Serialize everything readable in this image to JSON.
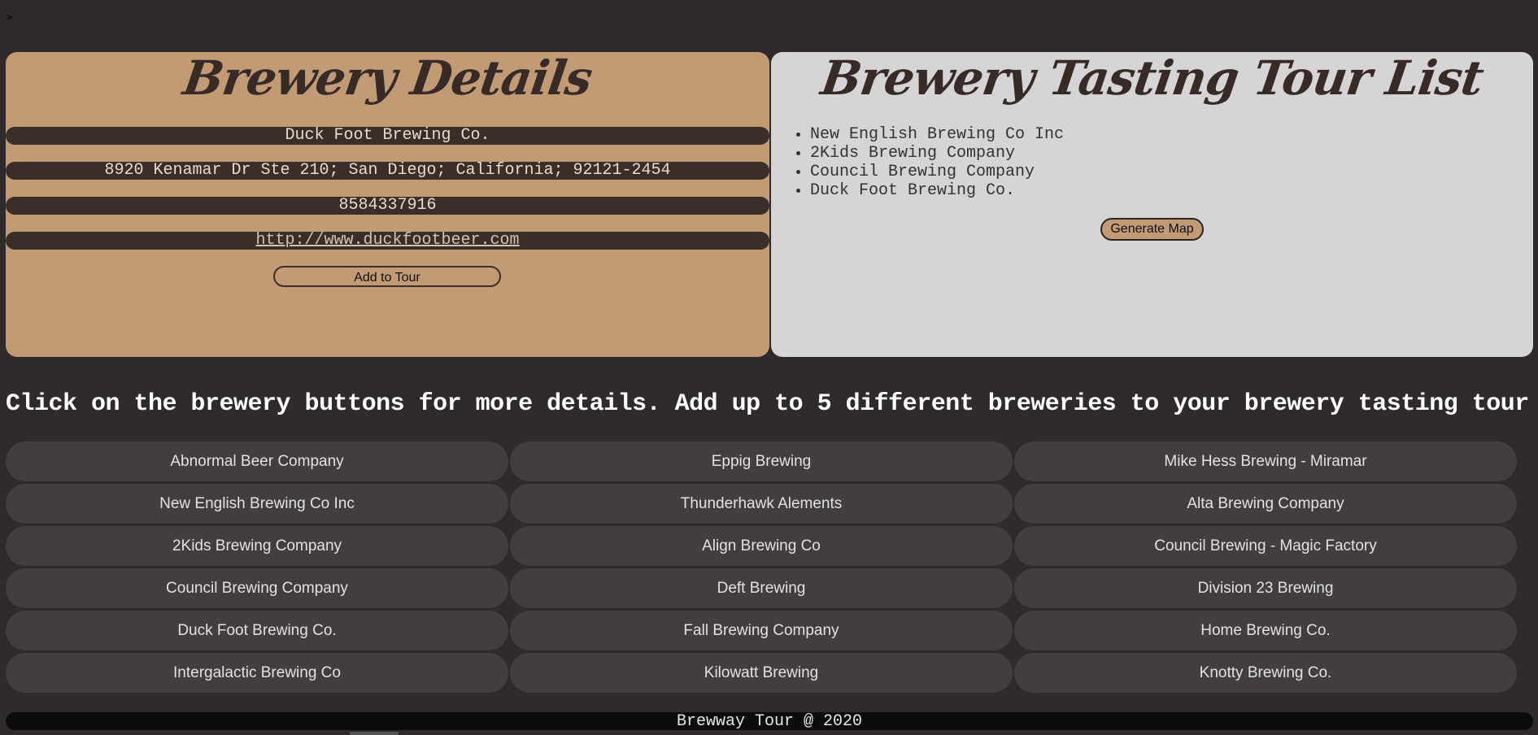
{
  "top_glyph": ">",
  "details": {
    "title": "Brewery Details",
    "name": "Duck Foot Brewing Co.",
    "address": "8920 Kenamar Dr Ste 210; San Diego; California; 92121-2454",
    "phone": "8584337916",
    "website": "http://www.duckfootbeer.com",
    "add_button": "Add to Tour"
  },
  "tour": {
    "title": "Brewery Tasting Tour List",
    "items": [
      "New English Brewing Co Inc",
      "2Kids Brewing Company",
      "Council Brewing Company",
      "Duck Foot Brewing Co."
    ],
    "generate_button": "Generate Map"
  },
  "instructions": "Click on the brewery buttons for more details. Add up to 5 different breweries to your brewery tasting tour list.",
  "breweries": [
    "Abnormal Beer Company",
    "Eppig Brewing",
    "Mike Hess Brewing - Miramar",
    "New English Brewing Co Inc",
    "Thunderhawk Alements",
    "Alta Brewing Company",
    "2Kids Brewing Company",
    "Align Brewing Co",
    "Council Brewing - Magic Factory",
    "Council Brewing Company",
    "Deft Brewing",
    "Division 23 Brewing",
    "Duck Foot Brewing Co.",
    "Fall Brewing Company",
    "Home Brewing Co.",
    "Intergalactic Brewing Co",
    "Kilowatt Brewing",
    "Knotty Brewing Co."
  ],
  "footer": "Brewway Tour @ 2020",
  "colors": {
    "background": "#2f2b2a",
    "details_panel": "#c29b74",
    "tour_panel": "#d5d5d5",
    "brewery_button": "#423e3d"
  }
}
